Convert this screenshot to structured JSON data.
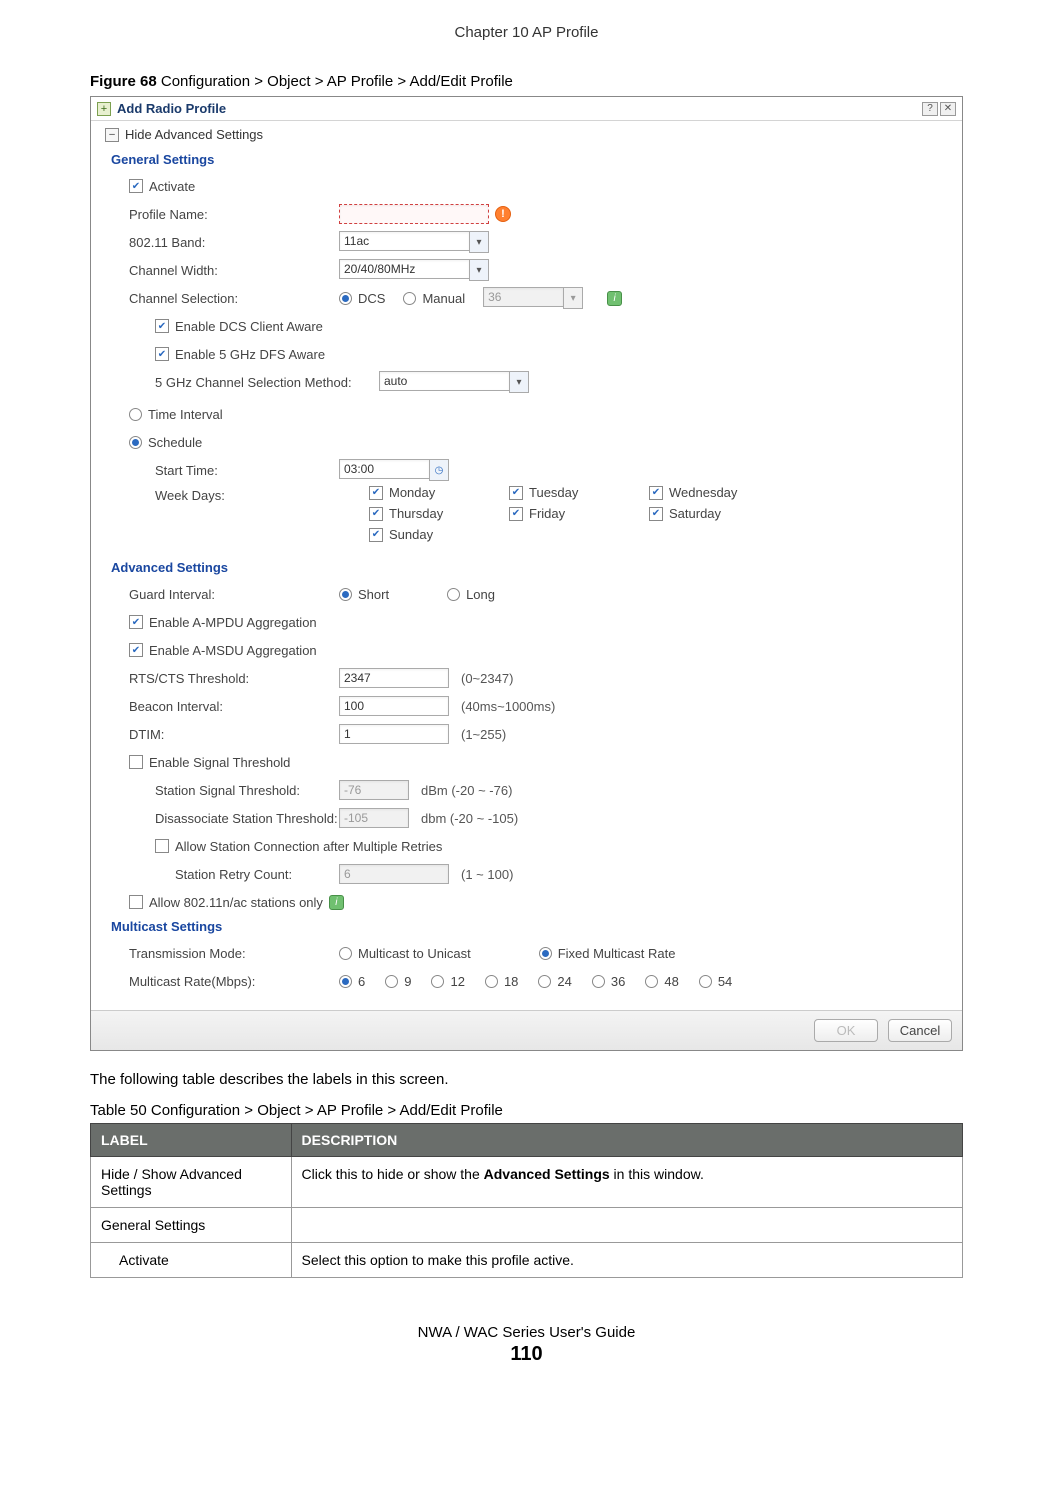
{
  "page": {
    "chapter_header": "Chapter 10 AP Profile",
    "figure_caption_bold": "Figure 68",
    "figure_caption_rest": "   Configuration > Object > AP Profile > Add/Edit Profile",
    "body_text": "The following table describes the labels in this screen.",
    "table_caption": "Table 50   Configuration > Object > AP Profile > Add/Edit Profile",
    "footer_guide": "NWA / WAC Series User's Guide",
    "footer_page": "110"
  },
  "screenshot": {
    "titlebar": {
      "title": "Add Radio Profile"
    },
    "hide_adv": "Hide Advanced Settings",
    "sections": {
      "general": "General Settings",
      "advanced": "Advanced Settings",
      "multicast": "Multicast Settings"
    },
    "general": {
      "activate": "Activate",
      "profile_name_label": "Profile Name:",
      "profile_name_value": "",
      "band_label": "802.11 Band:",
      "band_value": "11ac",
      "ch_width_label": "Channel Width:",
      "ch_width_value": "20/40/80MHz",
      "ch_sel_label": "Channel Selection:",
      "ch_sel_dcs": "DCS",
      "ch_sel_manual": "Manual",
      "ch_sel_manual_value": "36",
      "dcs_aware": "Enable DCS Client Aware",
      "dfs_aware": "Enable 5 GHz DFS Aware",
      "five_g_method_label": "5 GHz Channel Selection Method:",
      "five_g_method_value": "auto",
      "time_interval": "Time Interval",
      "schedule": "Schedule",
      "start_time_label": "Start Time:",
      "start_time_value": "03:00",
      "week_days_label": "Week Days:",
      "days": [
        "Monday",
        "Tuesday",
        "Wednesday",
        "Thursday",
        "Friday",
        "Saturday",
        "Sunday"
      ]
    },
    "advanced": {
      "guard_label": "Guard Interval:",
      "guard_short": "Short",
      "guard_long": "Long",
      "ampdu": "Enable A-MPDU Aggregation",
      "amsdu": "Enable A-MSDU Aggregation",
      "rtscts_label": "RTS/CTS Threshold:",
      "rtscts_value": "2347",
      "rtscts_hint": "(0~2347)",
      "beacon_label": "Beacon Interval:",
      "beacon_value": "100",
      "beacon_hint": "(40ms~1000ms)",
      "dtim_label": "DTIM:",
      "dtim_value": "1",
      "dtim_hint": "(1~255)",
      "sig_thresh": "Enable Signal Threshold",
      "sta_sig_label": "Station Signal Threshold:",
      "sta_sig_value": "-76",
      "sta_sig_hint": "dBm (-20 ~ -76)",
      "dis_sta_label": "Disassociate Station Threshold:",
      "dis_sta_value": "-105",
      "dis_sta_hint": "dbm (-20 ~ -105)",
      "allow_retry": "Allow Station Connection after Multiple Retries",
      "retry_label": "Station Retry Count:",
      "retry_value": "6",
      "retry_hint": "(1 ~ 100)",
      "allow_11nac": "Allow 802.11n/ac stations only"
    },
    "multicast": {
      "tx_mode_label": "Transmission Mode:",
      "tx_mode_unicast": "Multicast to Unicast",
      "tx_mode_fixed": "Fixed Multicast Rate",
      "rate_label": "Multicast Rate(Mbps):",
      "rates": [
        "6",
        "9",
        "12",
        "18",
        "24",
        "36",
        "48",
        "54"
      ]
    },
    "buttons": {
      "ok": "OK",
      "cancel": "Cancel"
    }
  },
  "table": {
    "header_label": "LABEL",
    "header_desc": "DESCRIPTION",
    "rows": [
      {
        "label": "Hide / Show Advanced Settings",
        "desc_pre": "Click this to hide or show the ",
        "desc_bold": "Advanced Settings",
        "desc_post": " in this window."
      },
      {
        "label": "General Settings",
        "desc": ""
      },
      {
        "label": "Activate",
        "indent": true,
        "desc": "Select this option to make this profile active."
      }
    ]
  }
}
